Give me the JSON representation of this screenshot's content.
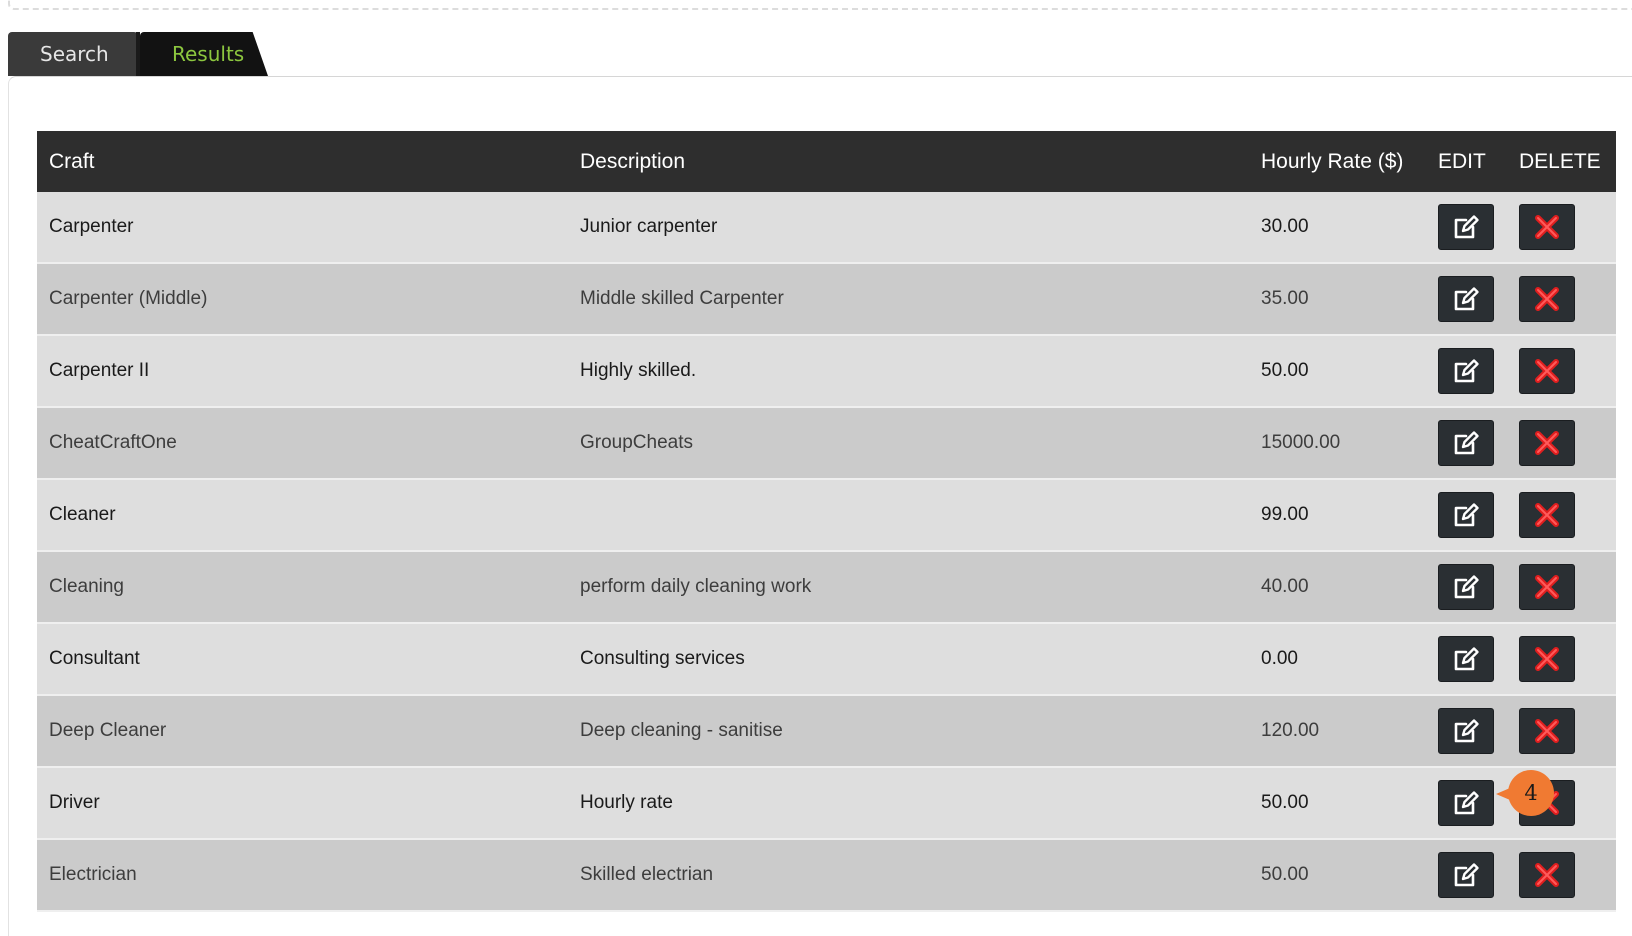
{
  "tabs": [
    {
      "label": "Search",
      "active": false
    },
    {
      "label": "Results",
      "active": true
    }
  ],
  "table": {
    "headers": {
      "craft": "Craft",
      "description": "Description",
      "hourly_rate": "Hourly Rate ($)",
      "edit": "EDIT",
      "delete": "DELETE"
    },
    "rows": [
      {
        "craft": "Carpenter",
        "description": "Junior carpenter",
        "rate": "30.00"
      },
      {
        "craft": "Carpenter (Middle)",
        "description": "Middle skilled Carpenter",
        "rate": "35.00"
      },
      {
        "craft": "Carpenter II",
        "description": "Highly skilled.",
        "rate": "50.00"
      },
      {
        "craft": "CheatCraftOne",
        "description": "GroupCheats",
        "rate": "15000.00"
      },
      {
        "craft": "Cleaner",
        "description": "",
        "rate": "99.00"
      },
      {
        "craft": "Cleaning",
        "description": "perform daily cleaning work",
        "rate": "40.00"
      },
      {
        "craft": "Consultant",
        "description": "Consulting services",
        "rate": "0.00"
      },
      {
        "craft": "Deep Cleaner",
        "description": "Deep cleaning - sanitise",
        "rate": "120.00"
      },
      {
        "craft": "Driver",
        "description": "Hourly rate",
        "rate": "50.00"
      },
      {
        "craft": "Electrician",
        "description": "Skilled electrian",
        "rate": "50.00"
      }
    ]
  },
  "icons": {
    "edit": "edit-pencil-icon",
    "delete": "red-x-icon"
  },
  "callout": {
    "label": "4"
  },
  "colors": {
    "header_bg": "#2e2e2e",
    "active_tab_text": "#8cc63f",
    "delete_x": "#e01e1e",
    "callout": "#f07a32"
  }
}
